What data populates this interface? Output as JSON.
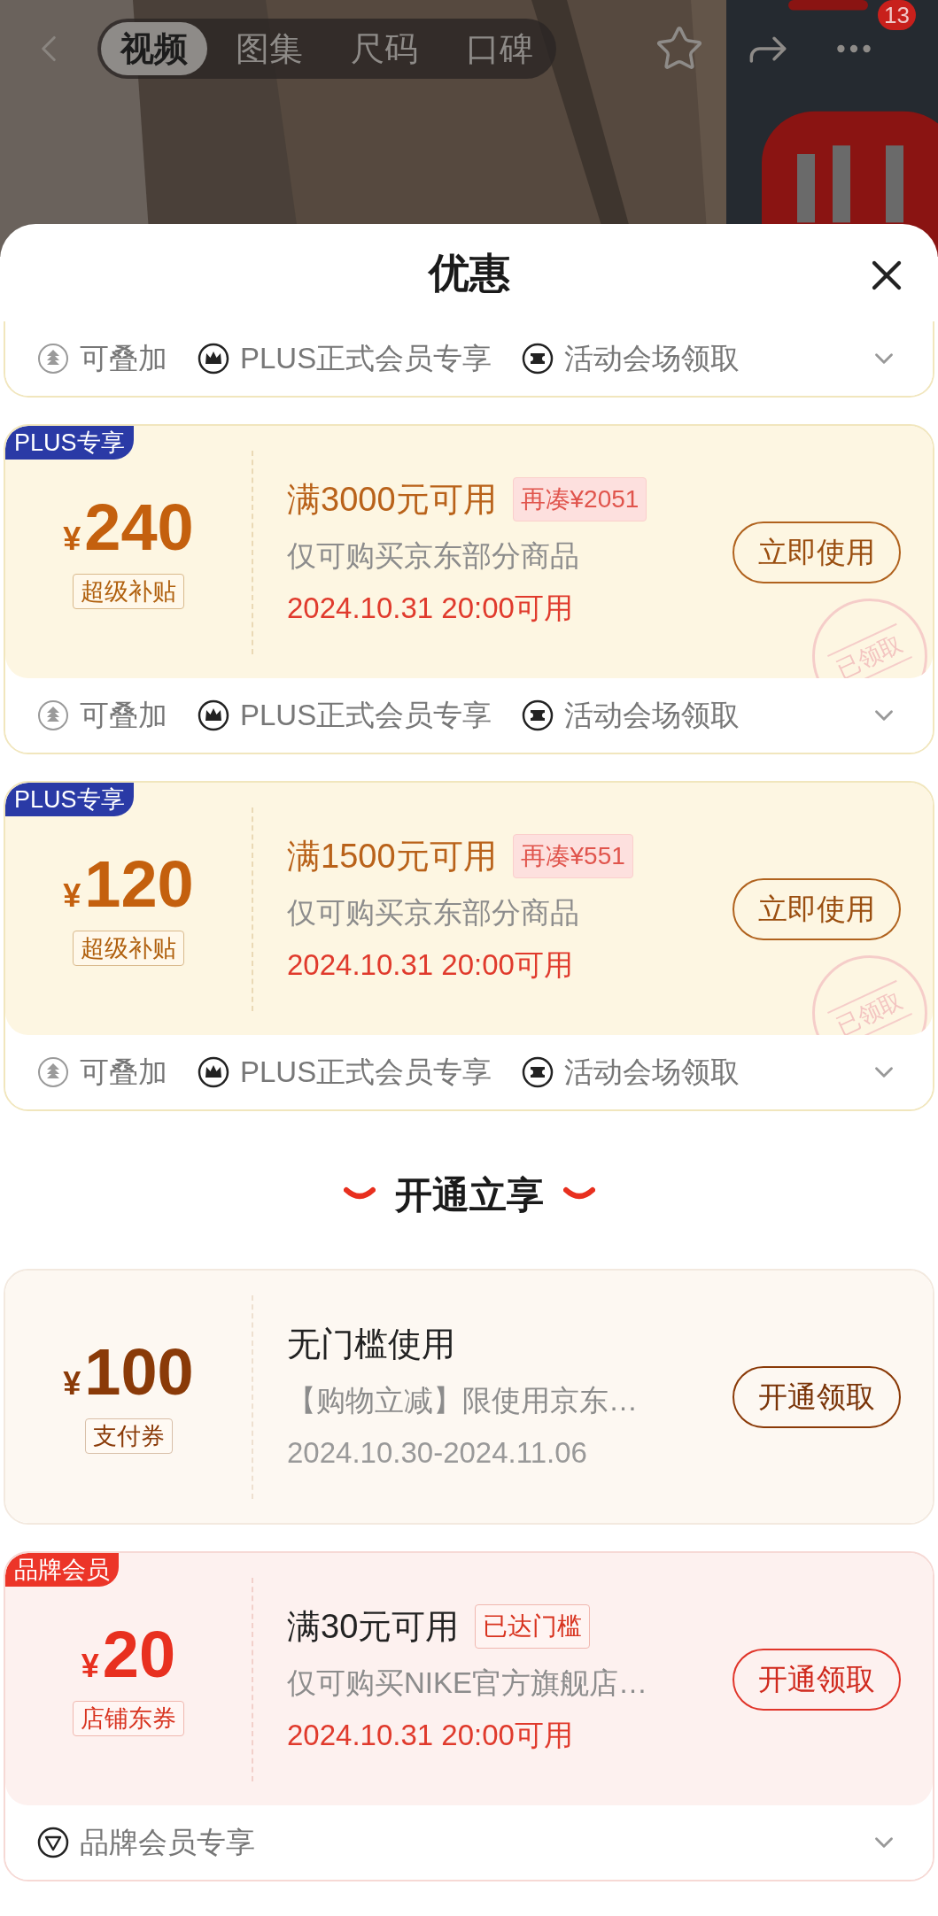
{
  "nav": {
    "tabs": [
      {
        "label": "视频",
        "selected": true
      },
      {
        "label": "图集",
        "selected": false
      },
      {
        "label": "尺码",
        "selected": false
      },
      {
        "label": "口碑",
        "selected": false
      }
    ],
    "more_badge": "13"
  },
  "sheet": {
    "title": "优惠"
  },
  "items": [
    {
      "kind": "features_only",
      "features": [
        {
          "kind": "stack",
          "label": "可叠加"
        },
        {
          "kind": "crown",
          "label": "PLUS正式会员专享"
        },
        {
          "kind": "ticket",
          "label": "活动会场领取"
        }
      ]
    },
    {
      "kind": "plus",
      "tag": "PLUS专享",
      "currency": "¥",
      "amount": "240",
      "type": "超级补贴",
      "condition": "满3000元可用",
      "hint": "再凑¥2051",
      "scope": "仅可购买京东部分商品",
      "time": "2024.10.31 20:00可用",
      "button": "立即使用",
      "stamp": "已领取",
      "features": [
        {
          "kind": "stack",
          "label": "可叠加"
        },
        {
          "kind": "crown",
          "label": "PLUS正式会员专享"
        },
        {
          "kind": "ticket",
          "label": "活动会场领取"
        }
      ]
    },
    {
      "kind": "plus",
      "tag": "PLUS专享",
      "currency": "¥",
      "amount": "120",
      "type": "超级补贴",
      "condition": "满1500元可用",
      "hint": "再凑¥551",
      "scope": "仅可购买京东部分商品",
      "time": "2024.10.31 20:00可用",
      "button": "立即使用",
      "stamp": "已领取",
      "features": [
        {
          "kind": "stack",
          "label": "可叠加"
        },
        {
          "kind": "crown",
          "label": "PLUS正式会员专享"
        },
        {
          "kind": "ticket",
          "label": "活动会场领取"
        }
      ]
    },
    {
      "kind": "section",
      "title": "开通立享"
    },
    {
      "kind": "payment",
      "currency": "¥",
      "amount": "100",
      "type": "支付券",
      "condition": "无门槛使用",
      "scope": "【购物立减】限使用京东…",
      "time": "2024.10.30-2024.11.06",
      "button": "开通领取"
    },
    {
      "kind": "brand",
      "tag": "品牌会员",
      "currency": "¥",
      "amount": "20",
      "type": "店铺东券",
      "condition": "满30元可用",
      "hint": "已达门槛",
      "scope": "仅可购买NIKE官方旗舰店…",
      "time": "2024.10.31 20:00可用",
      "button": "开通领取",
      "features": [
        {
          "kind": "brand",
          "label": "品牌会员专享"
        }
      ]
    }
  ]
}
